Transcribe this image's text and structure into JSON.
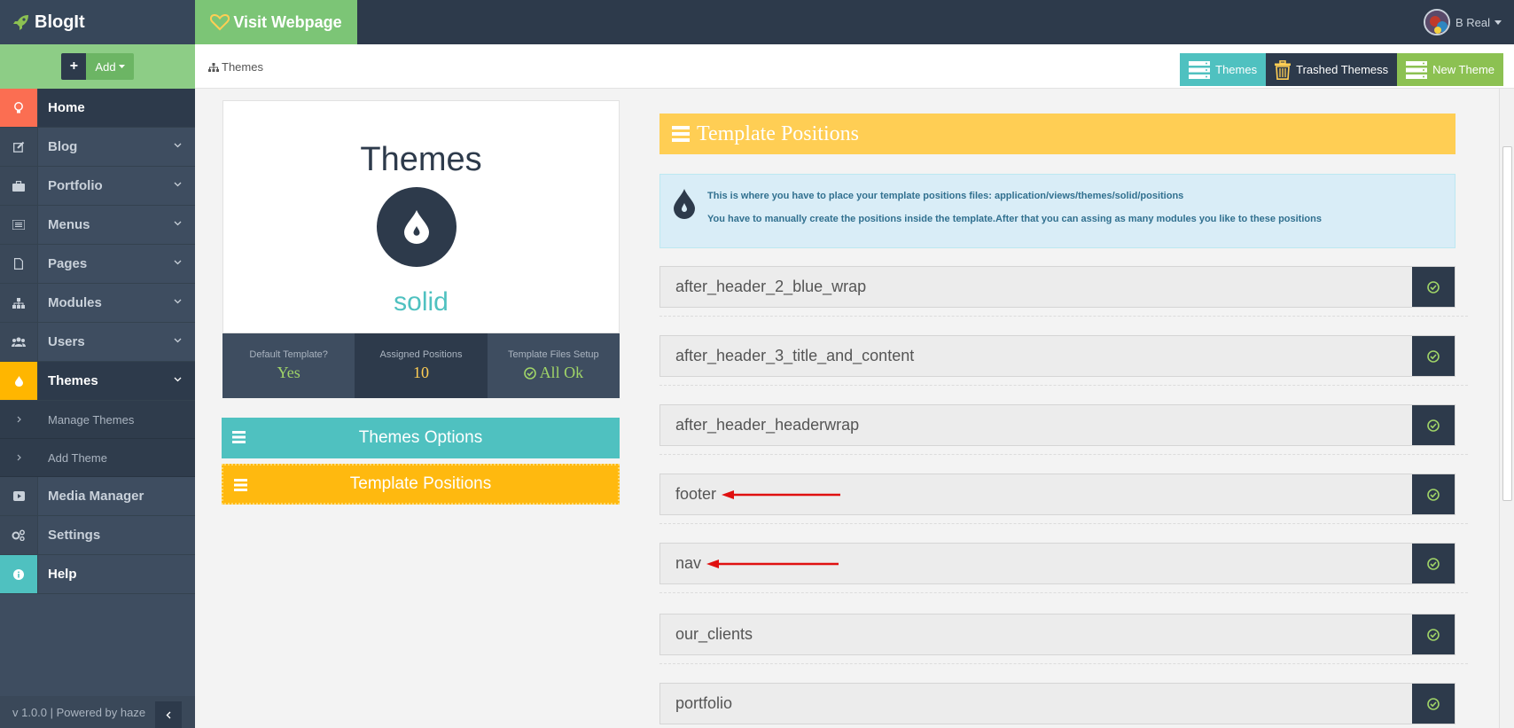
{
  "brand": {
    "name": "BlogIt",
    "icon": "rocket-icon"
  },
  "topbar": {
    "visit_label": "Visit Webpage",
    "user_name": "B Real"
  },
  "sidebar": {
    "add_label": "Add",
    "items": [
      {
        "label": "Home",
        "icon": "lightbulb-icon"
      },
      {
        "label": "Blog",
        "icon": "edit-icon"
      },
      {
        "label": "Portfolio",
        "icon": "briefcase-icon"
      },
      {
        "label": "Menus",
        "icon": "list-icon"
      },
      {
        "label": "Pages",
        "icon": "file-icon"
      },
      {
        "label": "Modules",
        "icon": "sitemap-icon"
      },
      {
        "label": "Users",
        "icon": "users-icon"
      },
      {
        "label": "Themes",
        "icon": "drop-icon"
      },
      {
        "label": "Media Manager",
        "icon": "video-icon"
      },
      {
        "label": "Settings",
        "icon": "cogs-icon"
      },
      {
        "label": "Help",
        "icon": "info-icon"
      }
    ],
    "subitems": [
      {
        "label": "Manage Themes"
      },
      {
        "label": "Add Theme"
      }
    ],
    "footer": "v 1.0.0 | Powered by haze"
  },
  "header": {
    "breadcrumb": "Themes",
    "actions": [
      {
        "label": "Themes"
      },
      {
        "label": "Trashed Themess"
      },
      {
        "label": "New Theme"
      }
    ]
  },
  "theme_card": {
    "title": "Themes",
    "theme_name": "solid",
    "stats": [
      {
        "label": "Default Template?",
        "value": "Yes"
      },
      {
        "label": "Assigned Positions",
        "value": "10"
      },
      {
        "label": "Template Files Setup",
        "value": "All Ok"
      }
    ],
    "options_label": "Themes Options",
    "positions_label": "Template Positions"
  },
  "positions_panel": {
    "title": "Template Positions",
    "info_line1": "This is where you have to place your template positions files: application/views/themes/solid/positions",
    "info_line2": "You have to manually create the positions inside the template.After that you can assing as many modules you like to these positions",
    "rows": [
      "after_header_2_blue_wrap",
      "after_header_3_title_and_content",
      "after_header_headerwrap",
      "footer",
      "nav",
      "our_clients",
      "portfolio"
    ]
  },
  "colors": {
    "sidebar": "#3e4d60",
    "dark": "#2d3a4b",
    "green": "#7cc576",
    "teal": "#4fc1c0",
    "yellow": "#ffb600",
    "accent_red": "#fb6e52"
  }
}
